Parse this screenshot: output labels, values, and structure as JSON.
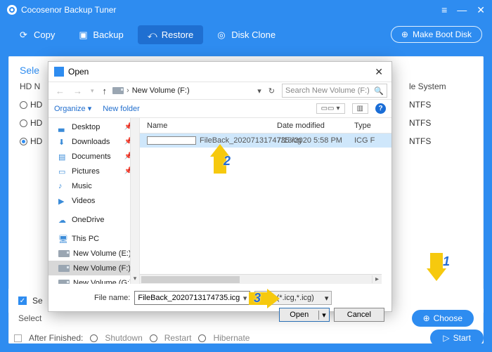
{
  "app": {
    "title": "Cocosenor Backup Tuner"
  },
  "winctl": {
    "menu": "≡",
    "min": "—",
    "close": "✕"
  },
  "toolbar": {
    "copy": "Copy",
    "backup": "Backup",
    "restore": "Restore",
    "clone": "Disk Clone",
    "bootdisk": "Make Boot Disk"
  },
  "panel": {
    "heading": "Sele",
    "cols": {
      "c1": "HD N",
      "c2": "",
      "c3": "",
      "c4": "le System"
    },
    "rows": [
      {
        "name": "HD",
        "fs": "NTFS",
        "checked": false
      },
      {
        "name": "HD",
        "fs": "NTFS",
        "checked": false
      },
      {
        "name": "HD",
        "fs": "NTFS",
        "checked": true
      }
    ],
    "se_label": "Se",
    "select_label": "Select",
    "choose": "Choose"
  },
  "after": {
    "label": "After Finished:",
    "opts": [
      "Shutdown",
      "Restart",
      "Hibernate"
    ],
    "start": "Start"
  },
  "dialog": {
    "title": "Open",
    "path_label": "New Volume (F:)",
    "search_placeholder": "Search New Volume (F:)",
    "organize": "Organize ▾",
    "newfolder": "New folder",
    "tree": [
      "Desktop",
      "Downloads",
      "Documents",
      "Pictures",
      "Music",
      "Videos",
      "OneDrive",
      "This PC",
      "New Volume (E:)",
      "New Volume (F:)",
      "New Volume (G:)"
    ],
    "cols": {
      "name": "Name",
      "date": "Date modified",
      "type": "Type"
    },
    "file": {
      "name": "FileBack_2020713174735.icg",
      "date": "7/13/2020 5:58 PM",
      "type": "ICG F"
    },
    "filename_label": "File name:",
    "filename_value": "FileBack_2020713174735.icg",
    "filter": "Files (*.icg,*.icg)",
    "open": "Open",
    "cancel": "Cancel"
  },
  "ann": {
    "n1": "1",
    "n2": "2",
    "n3": "3"
  }
}
